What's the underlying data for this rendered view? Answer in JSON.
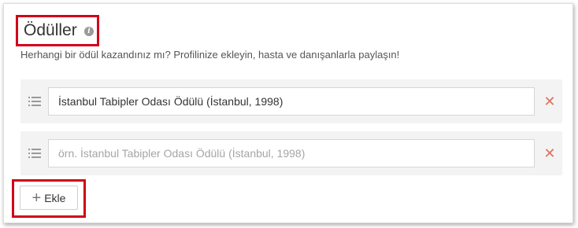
{
  "section": {
    "title": "Ödüller",
    "info_icon": "info-icon",
    "description": "Herhangi bir ödül kazandınız mı? Profilinize ekleyin, hasta ve danışanlarla paylaşın!"
  },
  "awards": [
    {
      "value": "İstanbul Tabipler Odası Ödülü (İstanbul, 1998)",
      "placeholder": ""
    },
    {
      "value": "",
      "placeholder": "örn. İstanbul Tabipler Odası Ödülü (İstanbul, 1998)"
    }
  ],
  "add_button": {
    "label": "Ekle",
    "icon": "plus-icon"
  },
  "colors": {
    "highlight": "#d0021b",
    "remove": "#e07060",
    "row_background": "#f3f3f3"
  }
}
